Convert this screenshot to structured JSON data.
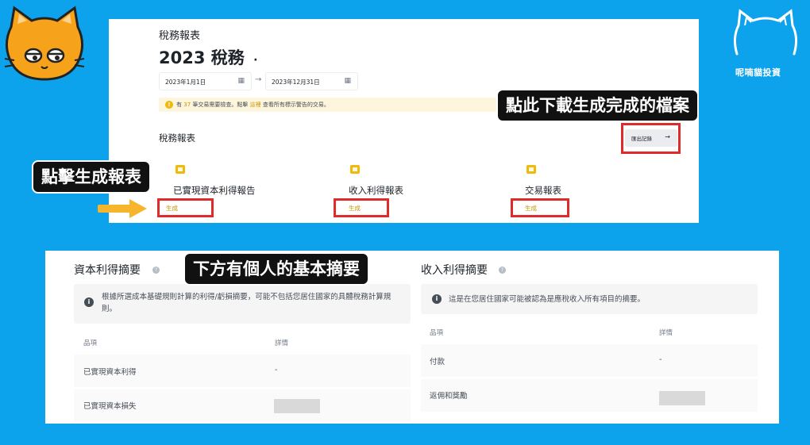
{
  "brand": {
    "name": "呢喃貓投資"
  },
  "tax_page": {
    "section_label": "稅務報表",
    "year_title": "2023 稅務",
    "year_caret": "·",
    "date_from": "2023年1月1日",
    "date_to": "2023年12月31日",
    "date_arrow": "→",
    "notice": {
      "prefix": "有",
      "count": "37",
      "middle": "筆交易需要檢查。點擊",
      "link": "這裡",
      "suffix": "查看所有標示警告的交易。"
    },
    "reports_title": "稅務報表",
    "export_button": "匯出記錄",
    "export_arrow": "→",
    "reports": [
      {
        "name": "已實現資本利得報告",
        "action": "生成"
      },
      {
        "name": "收入利得報表",
        "action": "生成"
      },
      {
        "name": "交易報表",
        "action": "生成"
      }
    ]
  },
  "summary": {
    "capital": {
      "title": "資本利得摘要",
      "info": "根據所選成本基礎規則計算的利得/虧損摘要，可能不包括您居住國家的具體稅務計算規則。",
      "col_item": "品項",
      "col_detail": "詳情",
      "rows": [
        {
          "item": "已實現資本利得",
          "detail": "-"
        },
        {
          "item": "已實現資本損失",
          "detail": ""
        }
      ]
    },
    "income": {
      "title": "收入利得摘要",
      "info": "這是在您居住國家可能被認為是應稅收入所有項目的摘要。",
      "col_item": "品項",
      "col_detail": "詳情",
      "rows": [
        {
          "item": "付款",
          "detail": "-"
        },
        {
          "item": "返佣和獎勵",
          "detail": ""
        }
      ]
    }
  },
  "callouts": {
    "download": "點此下載生成完成的檔案",
    "generate": "點擊生成報表",
    "summary": "下方有個人的基本摘要"
  },
  "colors": {
    "background": "#0da2ec",
    "highlight_box": "#e02b2b",
    "accent": "#f0b90b",
    "callout_bg": "#111111"
  }
}
